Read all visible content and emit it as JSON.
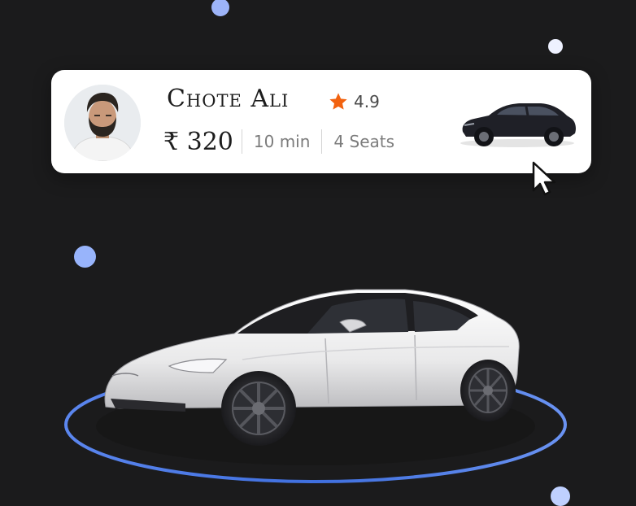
{
  "driver": {
    "name": "Chote Ali",
    "rating": "4.9",
    "price": "₹ 320",
    "eta": "10 min",
    "seats": "4 Seats"
  },
  "icons": [
    "star-icon",
    "cursor-pointer-icon"
  ],
  "colors": {
    "background": "#1b1b1c",
    "star": "#f2620f",
    "accent_ring": "#3f6fde",
    "dot": "#9db4f8"
  }
}
